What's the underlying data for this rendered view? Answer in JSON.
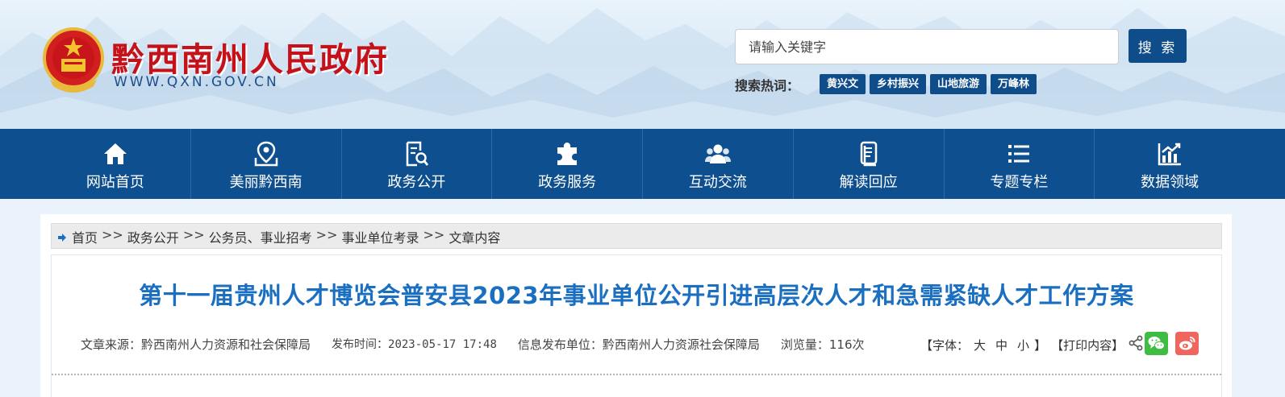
{
  "header": {
    "site_name": "黔西南州人民政府",
    "site_url": "WWW.QXN.GOV.CN",
    "search": {
      "placeholder": "请输入关键字",
      "button_label": "搜 索"
    },
    "hot_label": "搜索热词：",
    "hot_tags": [
      "黄兴文",
      "乡村振兴",
      "山地旅游",
      "万峰林"
    ]
  },
  "nav": {
    "items": [
      {
        "label": "网站首页",
        "icon": "home-icon"
      },
      {
        "label": "美丽黔西南",
        "icon": "map-pin-icon"
      },
      {
        "label": "政务公开",
        "icon": "document-search-icon"
      },
      {
        "label": "政务服务",
        "icon": "puzzle-icon"
      },
      {
        "label": "互动交流",
        "icon": "users-icon"
      },
      {
        "label": "解读回应",
        "icon": "file-icon"
      },
      {
        "label": "专题专栏",
        "icon": "list-icon"
      },
      {
        "label": "数据领域",
        "icon": "chart-icon"
      }
    ]
  },
  "breadcrumb": {
    "items": [
      "首页",
      "政务公开",
      "公务员、事业招考",
      "事业单位考录",
      "文章内容"
    ],
    "separator": ">>"
  },
  "article": {
    "title": "第十一届贵州人才博览会普安县2023年事业单位公开引进高层次人才和急需紧缺人才工作方案",
    "source": "文章来源：黔西南州人力资源和社会保障局",
    "publish_time": "发布时间：2023-05-17 17:48",
    "publisher": "信息发布单位：黔西南州人力资源社会保障局",
    "views": "浏览量：116次",
    "font_size_prefix": "【字体：",
    "font_large": "大",
    "font_medium": "中",
    "font_small": "小",
    "font_size_suffix": "】",
    "print_label": "【打印内容】"
  },
  "colors": {
    "brand_red": "#c5121a",
    "nav_blue": "#0e4f8f",
    "title_blue": "#1b6fc0",
    "wechat_green": "#3ebc43",
    "weibo_red": "#f0655e"
  }
}
